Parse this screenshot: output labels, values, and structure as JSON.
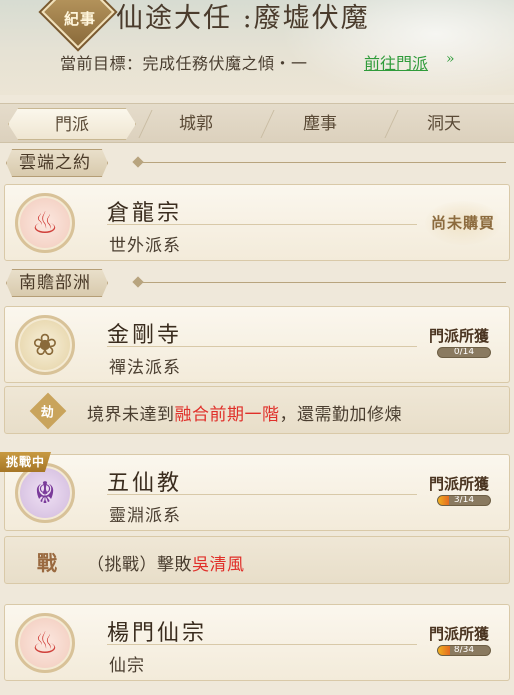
{
  "header": {
    "emblem_label": "紀事",
    "title": "仙途大任 :廢墟伏魔",
    "objective": "當前目標：完成任務伏魔之傾・一",
    "goto_link": "前往門派",
    "goto_arrow": "»"
  },
  "tabs": [
    {
      "label": "門派",
      "active": true
    },
    {
      "label": "城郭",
      "active": false
    },
    {
      "label": "塵事",
      "active": false
    },
    {
      "label": "洞天",
      "active": false
    }
  ],
  "sections": [
    {
      "title": "雲端之約"
    },
    {
      "title": "南贍部洲"
    }
  ],
  "cards": [
    {
      "name": "倉龍宗",
      "type": "世外派系",
      "icon": "flame-icon",
      "status": "尚未購買"
    },
    {
      "name": "金剛寺",
      "type": "禪法派系",
      "icon": "lotus-icon",
      "gain_label": "門派所獲",
      "progress_text": "0/14",
      "progress_value": 0,
      "progress_max": 14
    },
    {
      "name": "五仙教",
      "type": "靈淵派系",
      "icon": "demon-mask-icon",
      "gain_label": "門派所獲",
      "progress_text": "3/14",
      "progress_value": 3,
      "progress_max": 14,
      "tag": "挑戰中"
    },
    {
      "name": "楊門仙宗",
      "type": "仙宗",
      "icon": "flame-icon",
      "gain_label": "門派所獲",
      "progress_text": "8/34",
      "progress_value": 8,
      "progress_max": 34
    }
  ],
  "conditions": [
    {
      "icon": "realm-seal-icon",
      "seal_char": "劫",
      "prefix": "境界未達到",
      "highlight": "融合前期一階",
      "suffix": "，還需勤加修煉"
    },
    {
      "icon": "battle-icon",
      "seal_char": "戰",
      "prefix": "（挑戰）擊敗",
      "highlight": "吳清風",
      "suffix": ""
    }
  ],
  "colors": {
    "highlight": "#e0302a",
    "link": "#2f9b3a",
    "progress": "#f0b020"
  }
}
